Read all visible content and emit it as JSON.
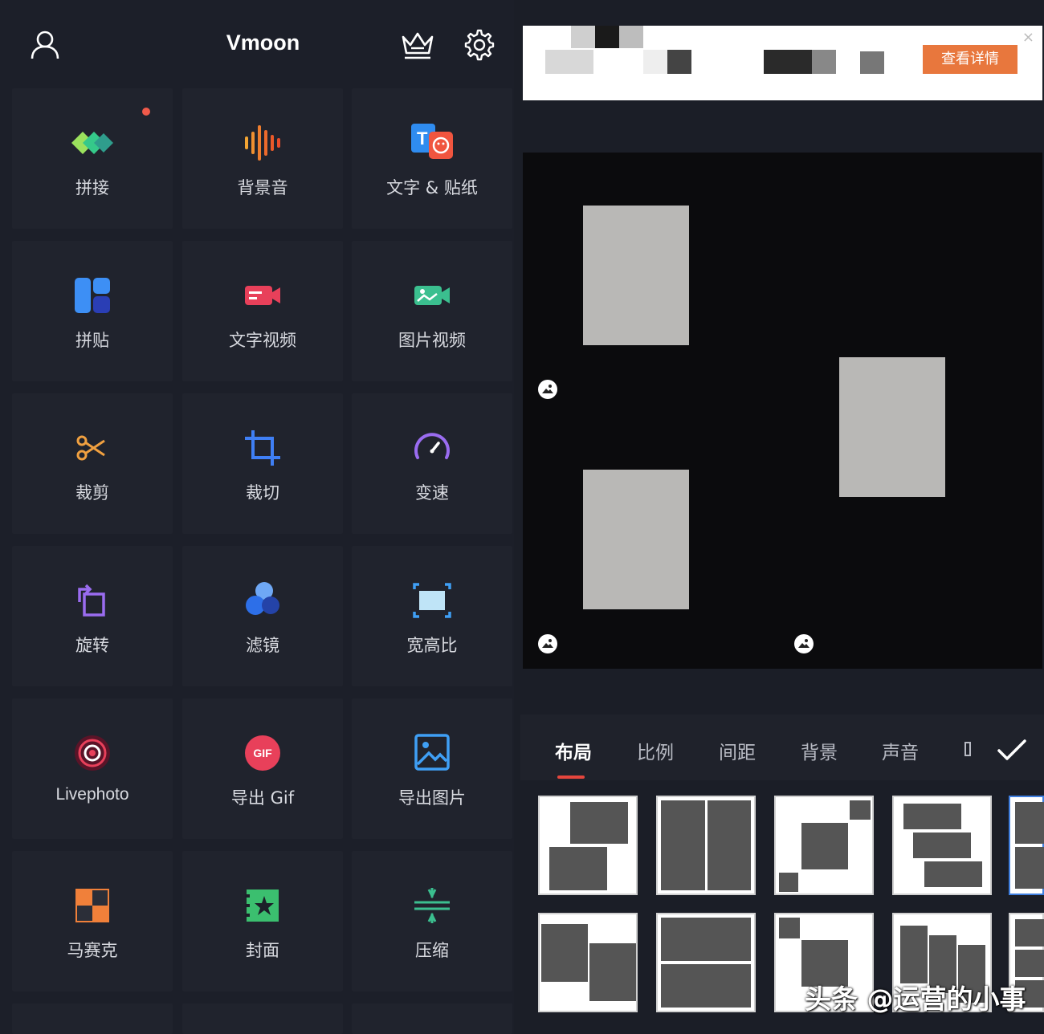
{
  "app_title": "Vmoon",
  "tools": [
    {
      "label": "拼接",
      "icon": "splice-icon"
    },
    {
      "label": "背景音",
      "icon": "background-music-icon"
    },
    {
      "label": "文字 & 贴纸",
      "icon": "text-sticker-icon"
    },
    {
      "label": "拼贴",
      "icon": "collage-icon"
    },
    {
      "label": "文字视频",
      "icon": "text-video-icon"
    },
    {
      "label": "图片视频",
      "icon": "photo-video-icon"
    },
    {
      "label": "裁剪",
      "icon": "scissors-icon"
    },
    {
      "label": "裁切",
      "icon": "crop-icon"
    },
    {
      "label": "变速",
      "icon": "speedometer-icon"
    },
    {
      "label": "旋转",
      "icon": "rotate-icon"
    },
    {
      "label": "滤镜",
      "icon": "filter-icon"
    },
    {
      "label": "宽高比",
      "icon": "aspect-ratio-icon"
    },
    {
      "label": "Livephoto",
      "icon": "livephoto-icon"
    },
    {
      "label": "导出 Gif",
      "icon": "gif-icon"
    },
    {
      "label": "导出图片",
      "icon": "export-image-icon"
    },
    {
      "label": "马赛克",
      "icon": "mosaic-icon"
    },
    {
      "label": "封面",
      "icon": "cover-icon"
    },
    {
      "label": "压缩",
      "icon": "compress-icon"
    }
  ],
  "gif_badge": "GIF",
  "ad": {
    "button_label": "查看详情",
    "close": "×"
  },
  "editor_tabs": [
    "布局",
    "比例",
    "间距",
    "背景",
    "声音"
  ],
  "active_tab": "布局",
  "colors": {
    "accent": "#e5463d",
    "ad_button": "#e8773d",
    "background": "#1c1f29"
  },
  "watermark": "头条 @运营的小事"
}
